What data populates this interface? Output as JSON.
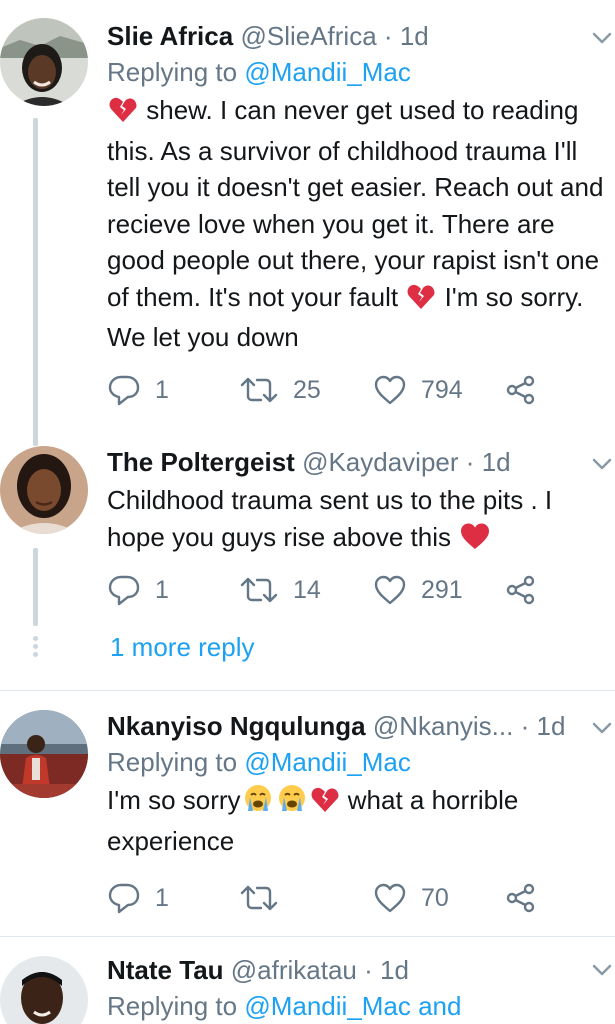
{
  "tweets": [
    {
      "name": "Slie Africa",
      "handle": "@SlieAfrica",
      "time": "1d",
      "reply_prefix": "Replying to",
      "reply_to": "@Mandii_Mac",
      "reply_suffix": "",
      "text_parts": [
        "shew. I can never get used to reading this. As a survivor of childhood trauma I'll tell you it doesn't get easier. Reach out and recieve love when you get it. There are good people out there, your rapist isn't one of them. It's not your fault",
        "I'm so sorry. We let you down"
      ],
      "replies": "1",
      "retweets": "25",
      "likes": "794"
    },
    {
      "name": "The Poltergeist",
      "handle": "@Kaydaviper",
      "time": "1d",
      "text": "Childhood trauma sent us to the pits . I hope you guys rise above this",
      "replies": "1",
      "retweets": "14",
      "likes": "291"
    },
    {
      "name": "Nkanyiso Ngqulunga",
      "handle": "@Nkanyis...",
      "time": "1d",
      "reply_prefix": "Replying to",
      "reply_to": "@Mandii_Mac",
      "text_parts": [
        "I'm so sorry",
        "what a horrible experience"
      ],
      "replies": "1",
      "retweets": "",
      "likes": "70"
    },
    {
      "name": "Ntate Tau",
      "handle": "@afrikatau",
      "time": "1d",
      "reply_prefix": "Replying to",
      "reply_to": "@Mandii_Mac and"
    }
  ],
  "more_reply": "1 more reply",
  "separator": "·",
  "icons": {
    "reply": "reply-icon",
    "retweet": "retweet-icon",
    "like": "heart-icon",
    "share": "share-icon",
    "caret": "chevron-down-icon",
    "broken_heart": "broken-heart-emoji",
    "red_heart": "red-heart-emoji",
    "crying": "loudly-crying-face-emoji"
  },
  "colors": {
    "link": "#1da1f2",
    "secondary": "#657786",
    "text": "#14171a",
    "thread_line": "#ccd6dd"
  }
}
